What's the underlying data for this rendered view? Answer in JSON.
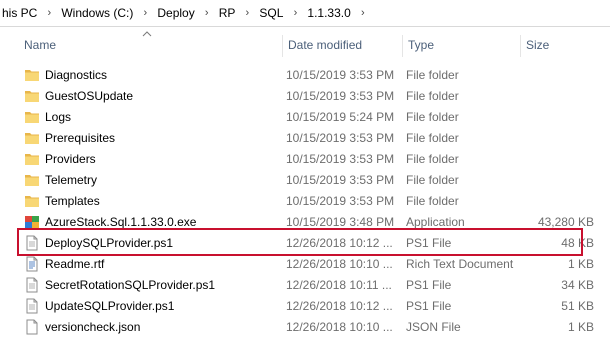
{
  "breadcrumb": [
    "his PC",
    "Windows (C:)",
    "Deploy",
    "RP",
    "SQL",
    "1.1.33.0"
  ],
  "columns": {
    "name": "Name",
    "date": "Date modified",
    "type": "Type",
    "size": "Size"
  },
  "colors": {
    "folder": "#f8d775",
    "highlight": "#c8102e",
    "header_text": "#4c607a"
  },
  "files": [
    {
      "name": "Diagnostics",
      "date": "10/15/2019 3:53 PM",
      "type": "File folder",
      "size": "",
      "icon": "folder-icon"
    },
    {
      "name": "GuestOSUpdate",
      "date": "10/15/2019 3:53 PM",
      "type": "File folder",
      "size": "",
      "icon": "folder-icon"
    },
    {
      "name": "Logs",
      "date": "10/15/2019 5:24 PM",
      "type": "File folder",
      "size": "",
      "icon": "folder-icon"
    },
    {
      "name": "Prerequisites",
      "date": "10/15/2019 3:53 PM",
      "type": "File folder",
      "size": "",
      "icon": "folder-icon"
    },
    {
      "name": "Providers",
      "date": "10/15/2019 3:53 PM",
      "type": "File folder",
      "size": "",
      "icon": "folder-icon"
    },
    {
      "name": "Telemetry",
      "date": "10/15/2019 3:53 PM",
      "type": "File folder",
      "size": "",
      "icon": "folder-icon"
    },
    {
      "name": "Templates",
      "date": "10/15/2019 3:53 PM",
      "type": "File folder",
      "size": "",
      "icon": "folder-icon"
    },
    {
      "name": "AzureStack.Sql.1.1.33.0.exe",
      "date": "10/15/2019 3:48 PM",
      "type": "Application",
      "size": "43,280 KB",
      "icon": "application-icon"
    },
    {
      "name": "DeploySQLProvider.ps1",
      "date": "12/26/2018 10:12 ...",
      "type": "PS1 File",
      "size": "48 KB",
      "icon": "script-file-icon"
    },
    {
      "name": "Readme.rtf",
      "date": "12/26/2018 10:10 ...",
      "type": "Rich Text Document",
      "size": "1 KB",
      "icon": "document-icon"
    },
    {
      "name": "SecretRotationSQLProvider.ps1",
      "date": "12/26/2018 10:11 ...",
      "type": "PS1 File",
      "size": "34 KB",
      "icon": "script-file-icon"
    },
    {
      "name": "UpdateSQLProvider.ps1",
      "date": "12/26/2018 10:12 ...",
      "type": "PS1 File",
      "size": "51 KB",
      "icon": "script-file-icon"
    },
    {
      "name": "versioncheck.json",
      "date": "12/26/2018 10:10 ...",
      "type": "JSON File",
      "size": "1 KB",
      "icon": "json-file-icon"
    }
  ]
}
